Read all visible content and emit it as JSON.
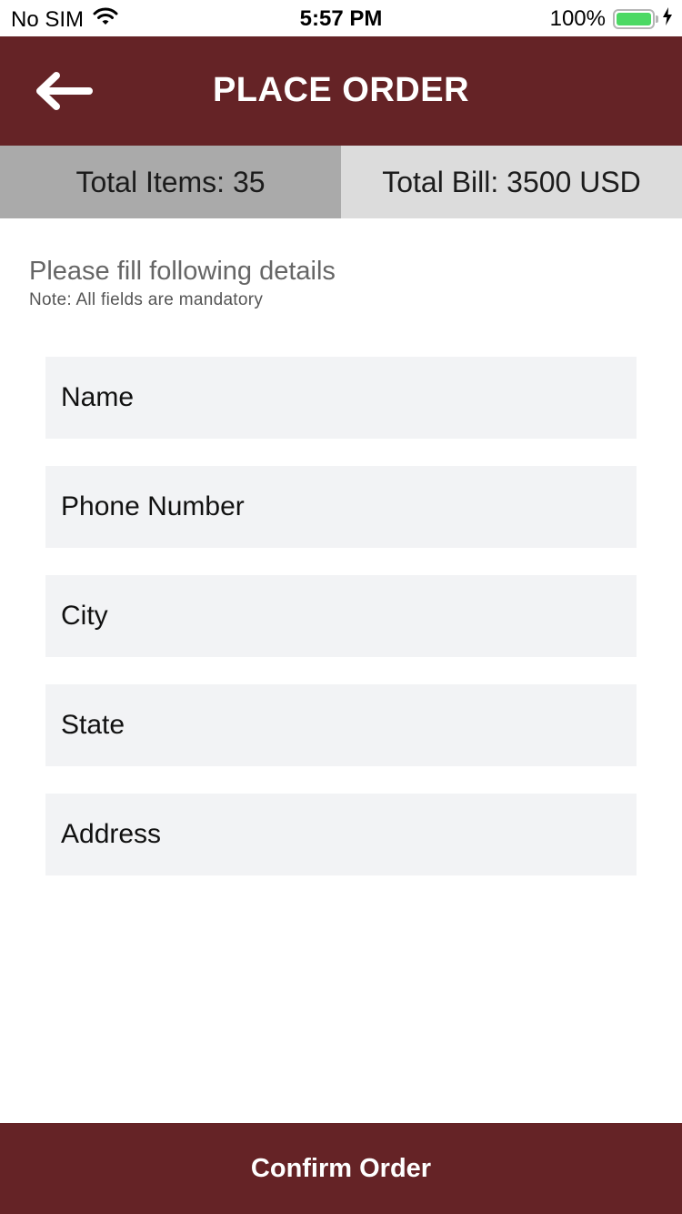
{
  "status_bar": {
    "carrier": "No SIM",
    "time": "5:57 PM",
    "battery": "100%",
    "icons": [
      "wifi-icon",
      "battery-icon",
      "charging-bolt-icon"
    ]
  },
  "header": {
    "title": "PLACE ORDER",
    "back_icon": "arrow-left-icon"
  },
  "summary": {
    "total_items": "Total Items: 35",
    "total_bill": "Total Bill: 3500 USD"
  },
  "form": {
    "heading": "Please fill following details",
    "note": "Note: All fields are mandatory",
    "fields": [
      {
        "placeholder": "Name",
        "value": ""
      },
      {
        "placeholder": "Phone Number",
        "value": ""
      },
      {
        "placeholder": "City",
        "value": ""
      },
      {
        "placeholder": "State",
        "value": ""
      },
      {
        "placeholder": "Address",
        "value": ""
      }
    ]
  },
  "confirm_label": "Confirm Order",
  "colors": {
    "brand": "#652326",
    "items_bg": "#aaaaaa",
    "bill_bg": "#dcdcdc",
    "field_bg": "#f2f3f5",
    "battery_green": "#4cd964"
  }
}
